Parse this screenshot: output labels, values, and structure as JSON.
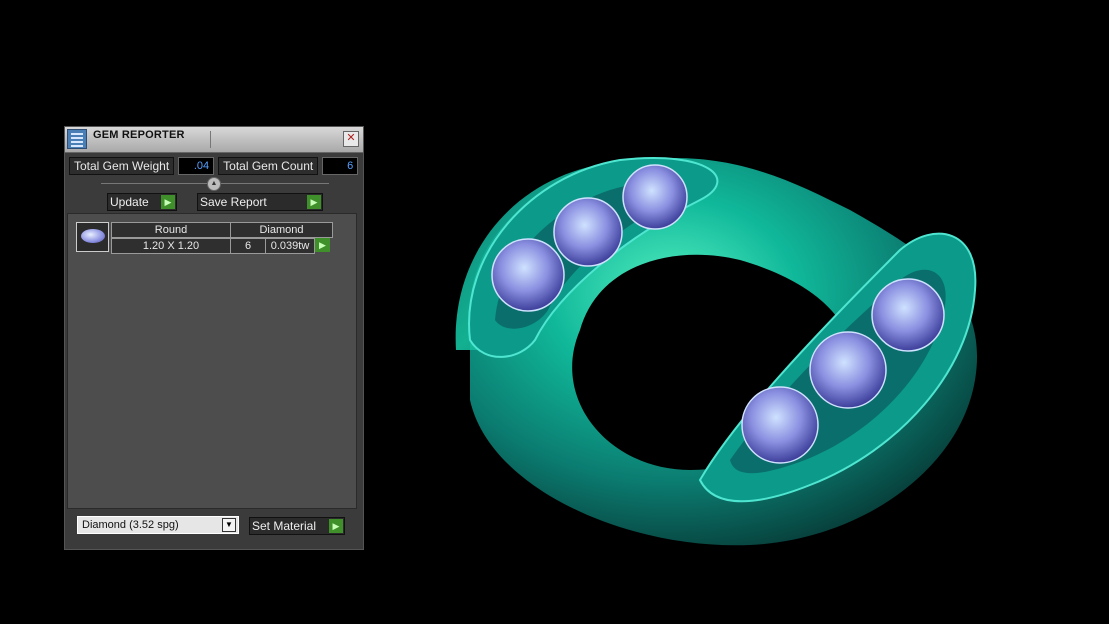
{
  "window": {
    "title": "GEM REPORTER",
    "close_icon": "close-icon",
    "icon": "gem-reporter-icon"
  },
  "summary": {
    "total_weight_label": "Total Gem Weight",
    "total_weight_value": ".04",
    "total_count_label": "Total Gem Count",
    "total_count_value": "6"
  },
  "toolbar": {
    "update_label": "Update",
    "save_report_label": "Save Report"
  },
  "gems": [
    {
      "shape": "Round",
      "material": "Diamond",
      "size": "1.20 X 1.20",
      "count": "6",
      "weight": "0.039tw"
    }
  ],
  "material_select": {
    "value": "Diamond      (3.52 spg)"
  },
  "set_material_label": "Set Material",
  "colors": {
    "accent_green": "#3f8f2a",
    "value_blue": "#56a0ff",
    "ring_teal": "#0fb39a",
    "gem_blue": "#8a8fe0"
  }
}
